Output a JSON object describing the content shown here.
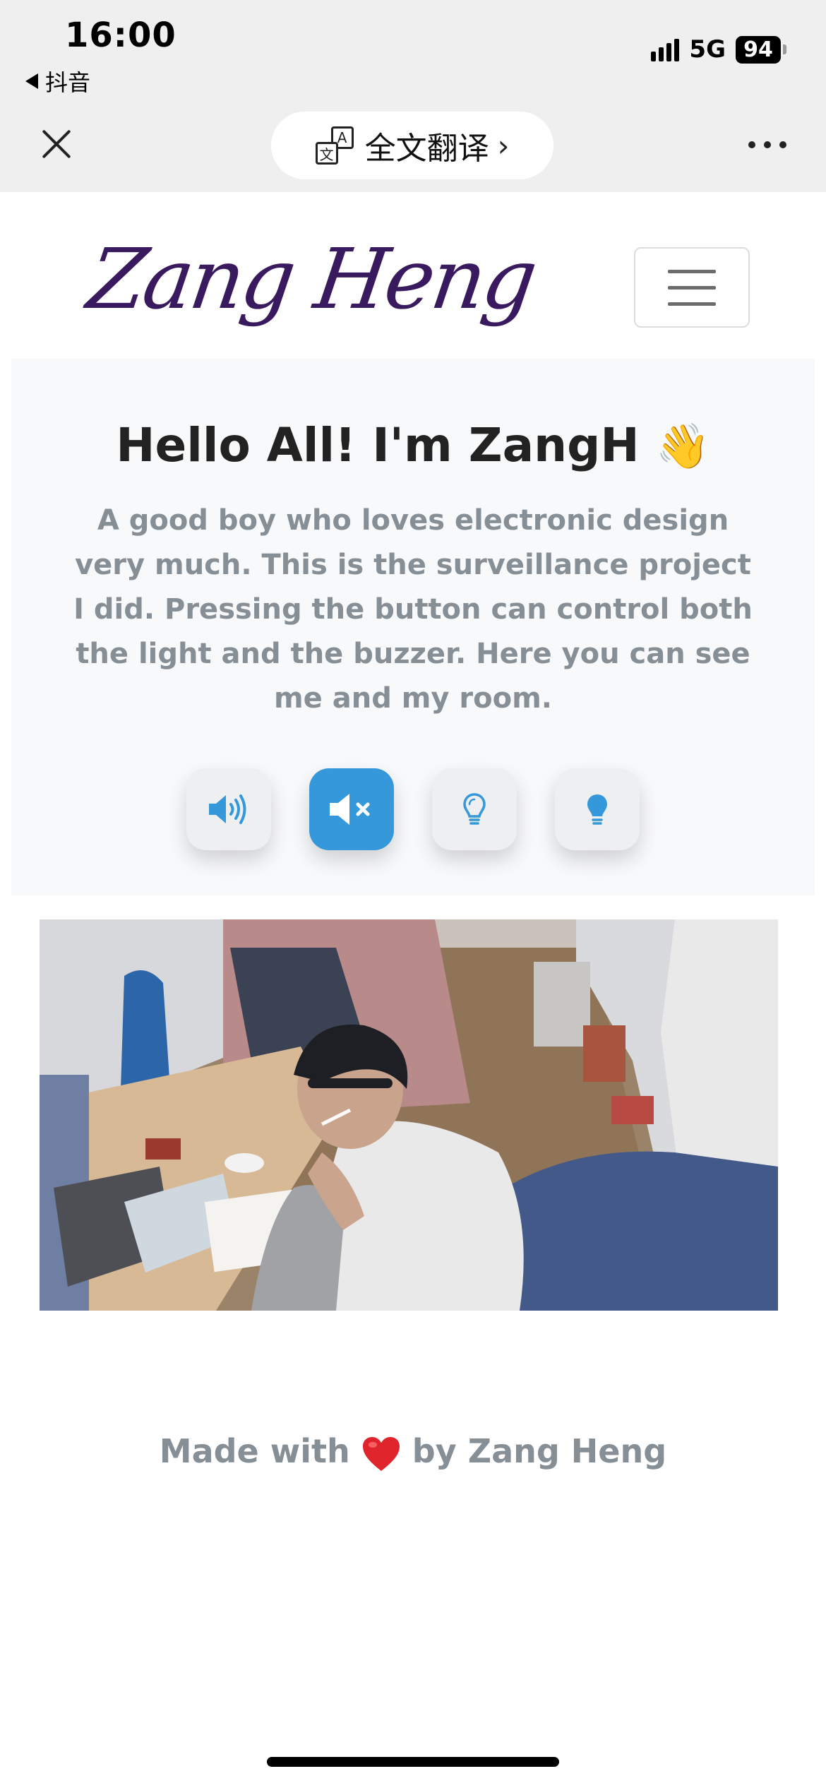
{
  "status": {
    "time": "16:00",
    "back_app": "抖音",
    "network": "5G",
    "battery": "94"
  },
  "browser": {
    "translate_label": "全文翻译",
    "translate_chevron": "›",
    "translate_icon_letters": [
      "A",
      "文"
    ]
  },
  "navbar": {
    "brand": "Zang Heng"
  },
  "hero": {
    "title": "Hello All! I'm ZangH",
    "wave_emoji": "👋",
    "description": "A good boy who loves electronic design very much. This is the surveillance project I did. Pressing the button can control both the light and the buzzer. Here you can see me and my room.",
    "controls": [
      {
        "name": "buzzer-on",
        "icon": "volume-up-icon",
        "active": false
      },
      {
        "name": "buzzer-off",
        "icon": "volume-mute-icon",
        "active": true
      },
      {
        "name": "light-off",
        "icon": "lightbulb-outline-icon",
        "active": false
      },
      {
        "name": "light-on",
        "icon": "lightbulb-filled-icon",
        "active": false
      }
    ]
  },
  "camera": {
    "feed": "camera-feed-room"
  },
  "footer": {
    "made_with": "Made with",
    "by": "by Zang Heng"
  },
  "colors": {
    "accent": "#3498db",
    "brand": "#3a1a5e",
    "muted_text": "#868e96",
    "heart": "#e0242c"
  }
}
